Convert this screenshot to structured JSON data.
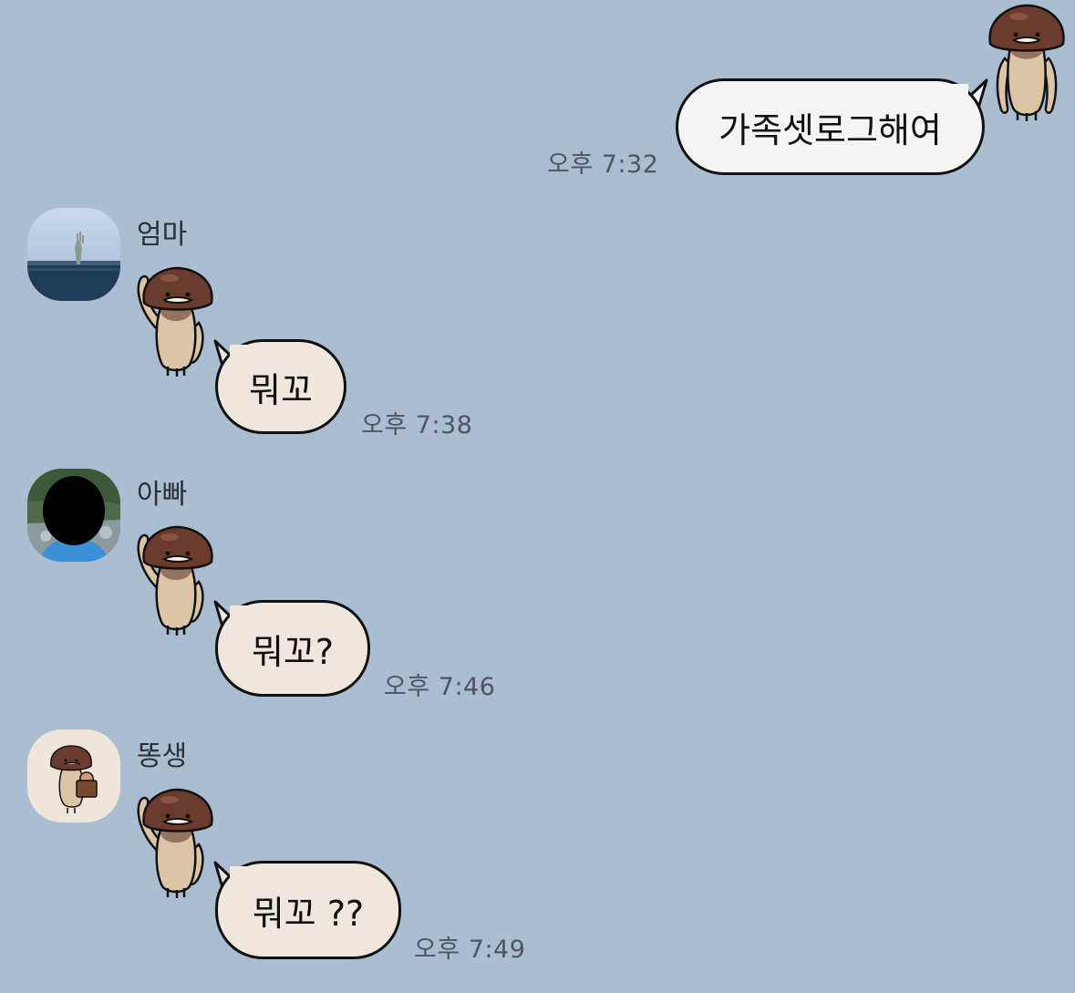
{
  "chat": {
    "messages": [
      {
        "sender": "me",
        "text": "가족셋로그해여",
        "time": "오후 7:32"
      },
      {
        "sender": "엄마",
        "avatar_icon": "sea-statue-photo-avatar",
        "text": "뭐꼬",
        "time": "오후 7:38"
      },
      {
        "sender": "아빠",
        "avatar_icon": "person-outdoor-photo-avatar",
        "text": "뭐꼬?",
        "time": "오후 7:46"
      },
      {
        "sender": "똥생",
        "avatar_icon": "mushroom-character-avatar",
        "text": "뭐꼬 ??",
        "time": "오후 7:49"
      }
    ]
  },
  "colors": {
    "background": "#abbdd1",
    "my_bubble": "#f4f4f4",
    "their_bubble": "#efe7dd",
    "bubble_border": "#111111",
    "mushroom_cap": "#6b3b2e",
    "mushroom_stem": "#dcc4a6"
  }
}
